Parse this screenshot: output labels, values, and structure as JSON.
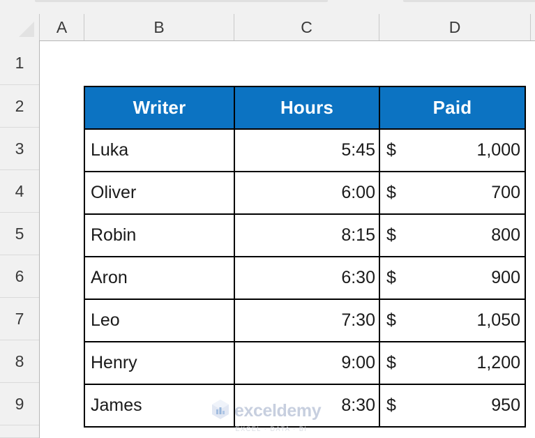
{
  "app": {
    "type": "spreadsheet",
    "background_color": "#ffffff"
  },
  "grid": {
    "column_headers": [
      "A",
      "B",
      "C",
      "D"
    ],
    "row_headers": [
      "1",
      "2",
      "3",
      "4",
      "5",
      "6",
      "7",
      "8",
      "9"
    ],
    "select_all_icon": "select-all-triangle-icon",
    "header_fill": "#f1f1f1",
    "header_text_color": "#3a3a3a",
    "gridline_color": "#dadada"
  },
  "table": {
    "accent_color": "#0c73c2",
    "border_color": "#000000",
    "header_text_color": "#ffffff",
    "body_text_color": "#1a1a1a",
    "columns": [
      "Writer",
      "Hours",
      "Paid"
    ],
    "rows": [
      {
        "writer": "Luka",
        "hours": "5:45",
        "paid_symbol": "$",
        "paid_amount": "1,000"
      },
      {
        "writer": "Oliver",
        "hours": "6:00",
        "paid_symbol": "$",
        "paid_amount": "700"
      },
      {
        "writer": "Robin",
        "hours": "8:15",
        "paid_symbol": "$",
        "paid_amount": "800"
      },
      {
        "writer": "Aron",
        "hours": "6:30",
        "paid_symbol": "$",
        "paid_amount": "900"
      },
      {
        "writer": "Leo",
        "hours": "7:30",
        "paid_symbol": "$",
        "paid_amount": "1,050"
      },
      {
        "writer": "Henry",
        "hours": "9:00",
        "paid_symbol": "$",
        "paid_amount": "1,200"
      },
      {
        "writer": "James",
        "hours": "8:30",
        "paid_symbol": "$",
        "paid_amount": "950"
      }
    ]
  },
  "watermark": {
    "name": "exceldemy",
    "tagline": "EXCEL · DATA · BI",
    "logo_icon": "exceldemy-cube-logo-icon",
    "name_color": "#c3cbdd",
    "tagline_color": "#d4d8e0"
  }
}
